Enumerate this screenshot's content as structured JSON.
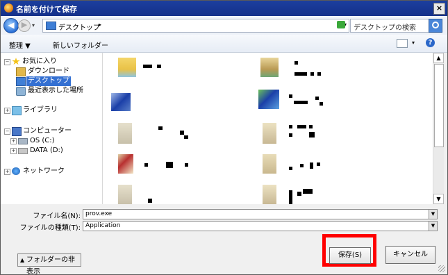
{
  "window": {
    "title": "名前を付けて保存",
    "close_label": "×"
  },
  "address_bar": {
    "location": "デスクトップ",
    "location_chevron": "▸",
    "dropdown_glyph": "▾"
  },
  "search": {
    "placeholder": "デスクトップの検索"
  },
  "toolbar": {
    "organize_label": "整理 ▼",
    "new_folder_label": "新しいフォルダー",
    "view_dropdown_glyph": "▾",
    "help_label": "?"
  },
  "sidebar": {
    "favorites": "お気に入り",
    "downloads": "ダウンロード",
    "desktop": "デスクトップ",
    "recent": "最近表示した場所",
    "libraries": "ライブラリ",
    "computer": "コンピューター",
    "os_drive": "OS (C:)",
    "data_drive": "DATA (D:)",
    "network": "ネットワーク",
    "selected": "デスクトップ"
  },
  "form": {
    "filename_label": "ファイル名(N):",
    "filename_value": "prov.exe",
    "filetype_label": "ファイルの種類(T):",
    "filetype_value": "Application"
  },
  "buttons": {
    "hide_folders": "フォルダーの非表示",
    "save": "保存(S)",
    "cancel": "キャンセル"
  },
  "glyphs": {
    "expand_plus": "+",
    "collapse_minus": "−",
    "scroll_up": "▲",
    "scroll_down": "▼",
    "combo_dropdown": "▼",
    "hide_chevron": "▲",
    "back_arrow": "◀",
    "forward_arrow": "▶"
  },
  "colors": {
    "title_bar": "#1c3f9e",
    "selection": "#3470d2",
    "highlight_box": "#ff0000"
  }
}
